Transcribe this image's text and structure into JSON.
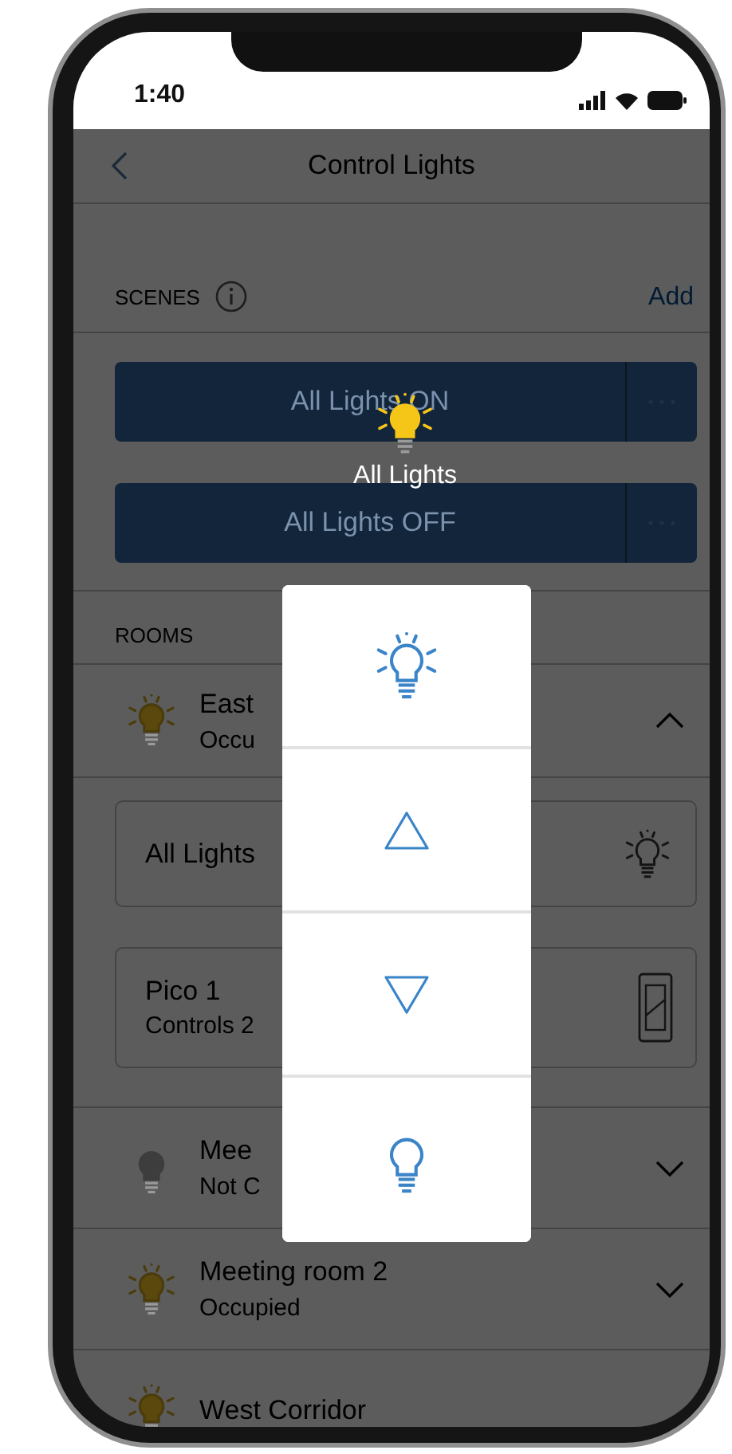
{
  "status_bar": {
    "time": "1:40"
  },
  "nav": {
    "title": "Control Lights"
  },
  "scenes": {
    "label": "SCENES",
    "add": "Add",
    "items": [
      {
        "name": "All Lights ON"
      },
      {
        "name": "All Lights OFF"
      }
    ]
  },
  "rooms": {
    "label": "ROOMS",
    "items": [
      {
        "name": "East",
        "status": "Occu",
        "lit": true,
        "expanded": true,
        "devices": [
          {
            "kind": "light",
            "name": "All Lights"
          },
          {
            "kind": "pico",
            "name": "Pico 1",
            "detail": "Controls 2"
          }
        ]
      },
      {
        "name": "Mee",
        "status": "Not C",
        "lit": false,
        "expanded": false
      },
      {
        "name": "Meeting room 2",
        "status": "Occupied",
        "lit": true,
        "expanded": false
      },
      {
        "name": "West Corridor",
        "lit": true
      }
    ]
  },
  "popup": {
    "title": "All Lights",
    "actions": [
      {
        "kind": "on"
      },
      {
        "kind": "raise"
      },
      {
        "kind": "lower"
      },
      {
        "kind": "off"
      }
    ]
  }
}
